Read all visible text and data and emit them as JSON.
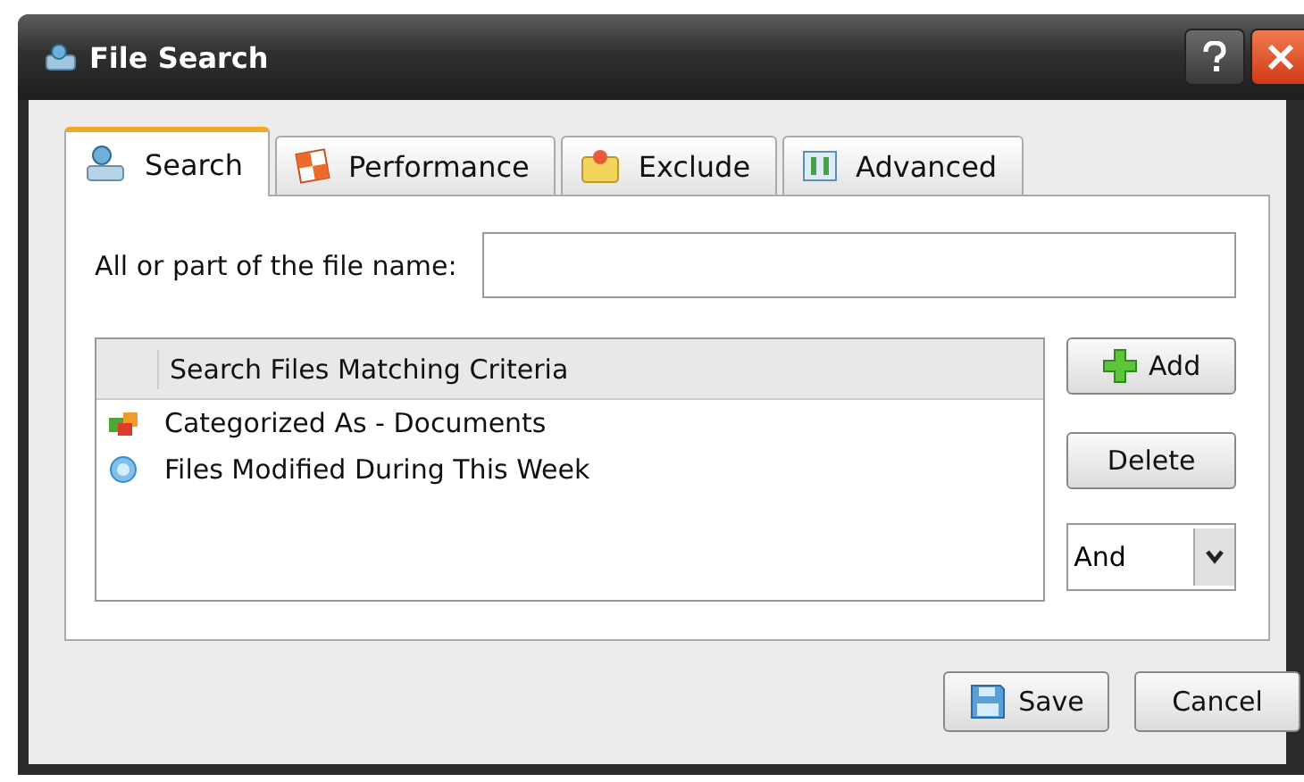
{
  "window": {
    "title": "File Search"
  },
  "tabs": [
    {
      "label": "Search",
      "kind": "search",
      "selected": true
    },
    {
      "label": "Performance",
      "kind": "performance",
      "selected": false
    },
    {
      "label": "Exclude",
      "kind": "exclude",
      "selected": false
    },
    {
      "label": "Advanced",
      "kind": "advanced",
      "selected": false
    }
  ],
  "filename": {
    "label": "All or part of the file name:"
  },
  "criteria": {
    "heading": "Search Files Matching Criteria",
    "rows": [
      {
        "text": "Categorized As - Documents",
        "kind": "category"
      },
      {
        "text": "Files Modified During This Week",
        "kind": "date"
      }
    ]
  },
  "side_buttons": {
    "add": "Add",
    "delete": "Delete",
    "combine": "And"
  },
  "buttons": {
    "save": "Save",
    "cancel": "Cancel"
  }
}
